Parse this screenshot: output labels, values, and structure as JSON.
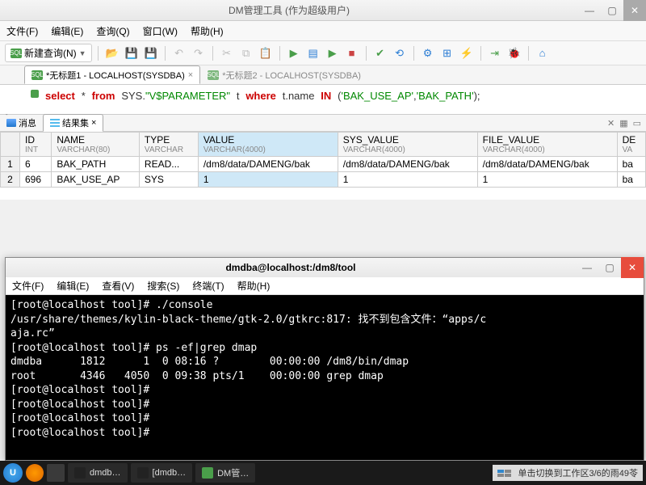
{
  "window": {
    "title": "DM管理工具 (作为超级用户)"
  },
  "menu": {
    "file": "文件(F)",
    "edit": "编辑(E)",
    "query": "查询(Q)",
    "window": "窗口(W)",
    "help": "帮助(H)"
  },
  "toolbar": {
    "newquery": "新建查询(N)"
  },
  "tabs": {
    "t1": "*无标题1 - LOCALHOST(SYSDBA)",
    "t2": "*无标题2 - LOCALHOST(SYSDBA)"
  },
  "sql": {
    "kw_select": "select",
    "star": "*",
    "kw_from": "from",
    "schema": "SYS",
    "dot": ".",
    "tbl": "\"V$PARAMETER\"",
    "alias": "t",
    "kw_where": "where",
    "col": "t.name",
    "kw_in": "IN",
    "lp": "(",
    "s1": "'BAK_USE_AP'",
    "comma": ",",
    "s2": "'BAK_PATH'",
    "rp": ")",
    "semi": ";"
  },
  "rtabs": {
    "msg": "消息",
    "rs": "结果集"
  },
  "cols": {
    "id": "ID",
    "id_t": "INT",
    "name": "NAME",
    "name_t": "VARCHAR(80)",
    "type": "TYPE",
    "type_t": "VARCHAR",
    "value": "VALUE",
    "value_t": "VARCHAR(4000)",
    "sys": "SYS_VALUE",
    "sys_t": "VARCHAR(4000)",
    "file": "FILE_VALUE",
    "file_t": "VARCHAR(4000)",
    "de": "DE",
    "de_t": "VA"
  },
  "rows": [
    {
      "n": "1",
      "id": "6",
      "name": "BAK_PATH",
      "type": "READ...",
      "value": "/dm8/data/DAMENG/bak",
      "sys": "/dm8/data/DAMENG/bak",
      "file": "/dm8/data/DAMENG/bak",
      "de": "ba"
    },
    {
      "n": "2",
      "id": "696",
      "name": "BAK_USE_AP",
      "type": "SYS",
      "value": "1",
      "sys": "1",
      "file": "1",
      "de": "ba"
    }
  ],
  "term": {
    "title": "dmdba@localhost:/dm8/tool",
    "menu": {
      "file": "文件(F)",
      "edit": "编辑(E)",
      "view": "查看(V)",
      "search": "搜索(S)",
      "terminal": "终端(T)",
      "help": "帮助(H)"
    },
    "lines": "[root@localhost tool]# ./console\n/usr/share/themes/kylin-black-theme/gtk-2.0/gtkrc:817: 找不到包含文件：“apps/c\naja.rc”\n[root@localhost tool]# ps -ef|grep dmap\ndmdba      1812      1  0 08:16 ?        00:00:00 /dm8/bin/dmap\nroot       4346   4050  0 09:38 pts/1    00:00:00 grep dmap\n[root@localhost tool]#\n[root@localhost tool]#\n[root@localhost tool]#\n[root@localhost tool]#"
  },
  "taskbar": {
    "t1": "dmdb…",
    "t2": "[dmdb…",
    "t3": "DM管…",
    "tray": "单击切换到工作区3/6的雨49苓"
  }
}
